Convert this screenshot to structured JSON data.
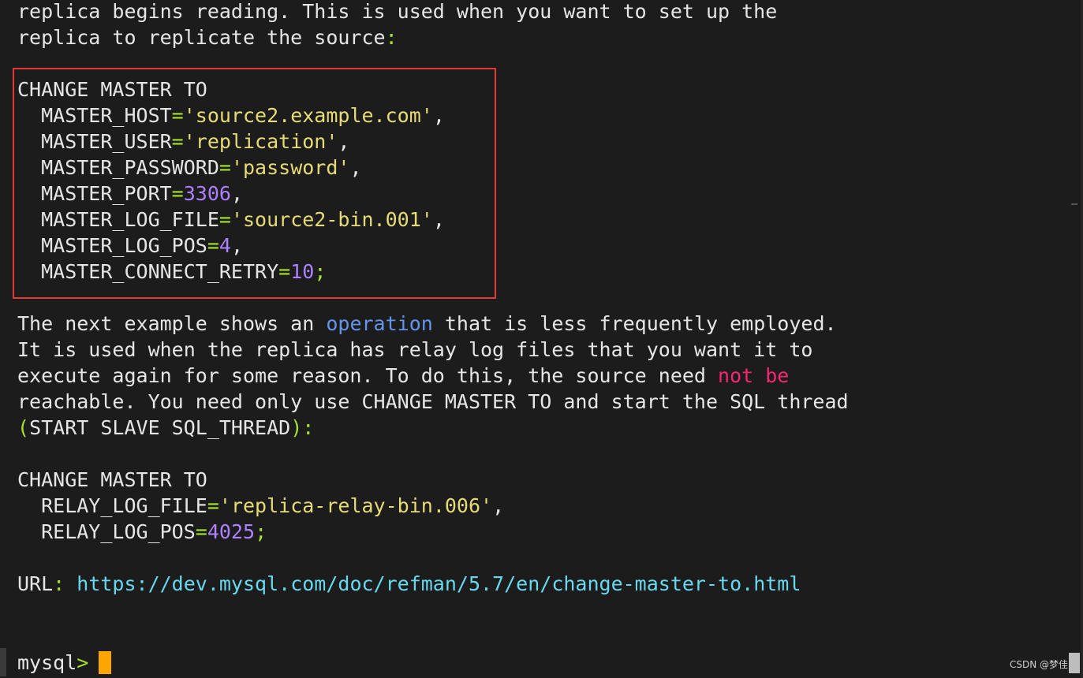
{
  "intro": {
    "line1": "replica begins reading. This is used when you want to set up the",
    "line2a": "replica to replicate the source",
    "line2b": ":"
  },
  "example1": {
    "head": "CHANGE MASTER TO",
    "host_key": "  MASTER_HOST",
    "host_val": "'source2.example.com'",
    "user_key": "  MASTER_USER",
    "user_val": "'replication'",
    "pass_key": "  MASTER_PASSWORD",
    "pass_val": "'password'",
    "port_key": "  MASTER_PORT",
    "port_val": "3306",
    "logfile_key": "  MASTER_LOG_FILE",
    "logfile_val": "'source2-bin.001'",
    "logpos_key": "  MASTER_LOG_POS",
    "logpos_val": "4",
    "retry_key": "  MASTER_CONNECT_RETRY",
    "retry_val": "10",
    "eq": "=",
    "comma": ",",
    "semicolon": ";"
  },
  "para": {
    "l1a": "The next example shows an ",
    "l1b": "operation",
    "l1c": " that is less frequently employed.",
    "l2": "It is used when the replica has relay log files that you want it to",
    "l3a": "execute again for some reason. To do this, the source need ",
    "l3b": "not be",
    "l4": "reachable. You need only use CHANGE MASTER TO and start the SQL thread",
    "l5a": "(",
    "l5b": "START SLAVE SQL_THREAD",
    "l5c": "):"
  },
  "example2": {
    "head": "CHANGE MASTER TO",
    "file_key": "  RELAY_LOG_FILE",
    "file_val": "'replica-relay-bin.006'",
    "pos_key": "  RELAY_LOG_POS",
    "pos_val": "4025"
  },
  "url": {
    "label": "URL",
    "colon": ": ",
    "link": "https://dev.mysql.com/doc/refman/5.7/en/change-master-to.html"
  },
  "prompt": {
    "text": "mysql",
    "arrow": ">"
  },
  "watermark": "CSDN @梦佳",
  "colors": {
    "background": "#1c1c1c",
    "string": "#e6db74",
    "number": "#ae81ff",
    "punctuation": "#a6e22e",
    "keyword": "#6495ed",
    "warning": "#f92672",
    "url": "#66d9ef",
    "cursor": "#ffa500",
    "highlight_border": "#e53935"
  }
}
